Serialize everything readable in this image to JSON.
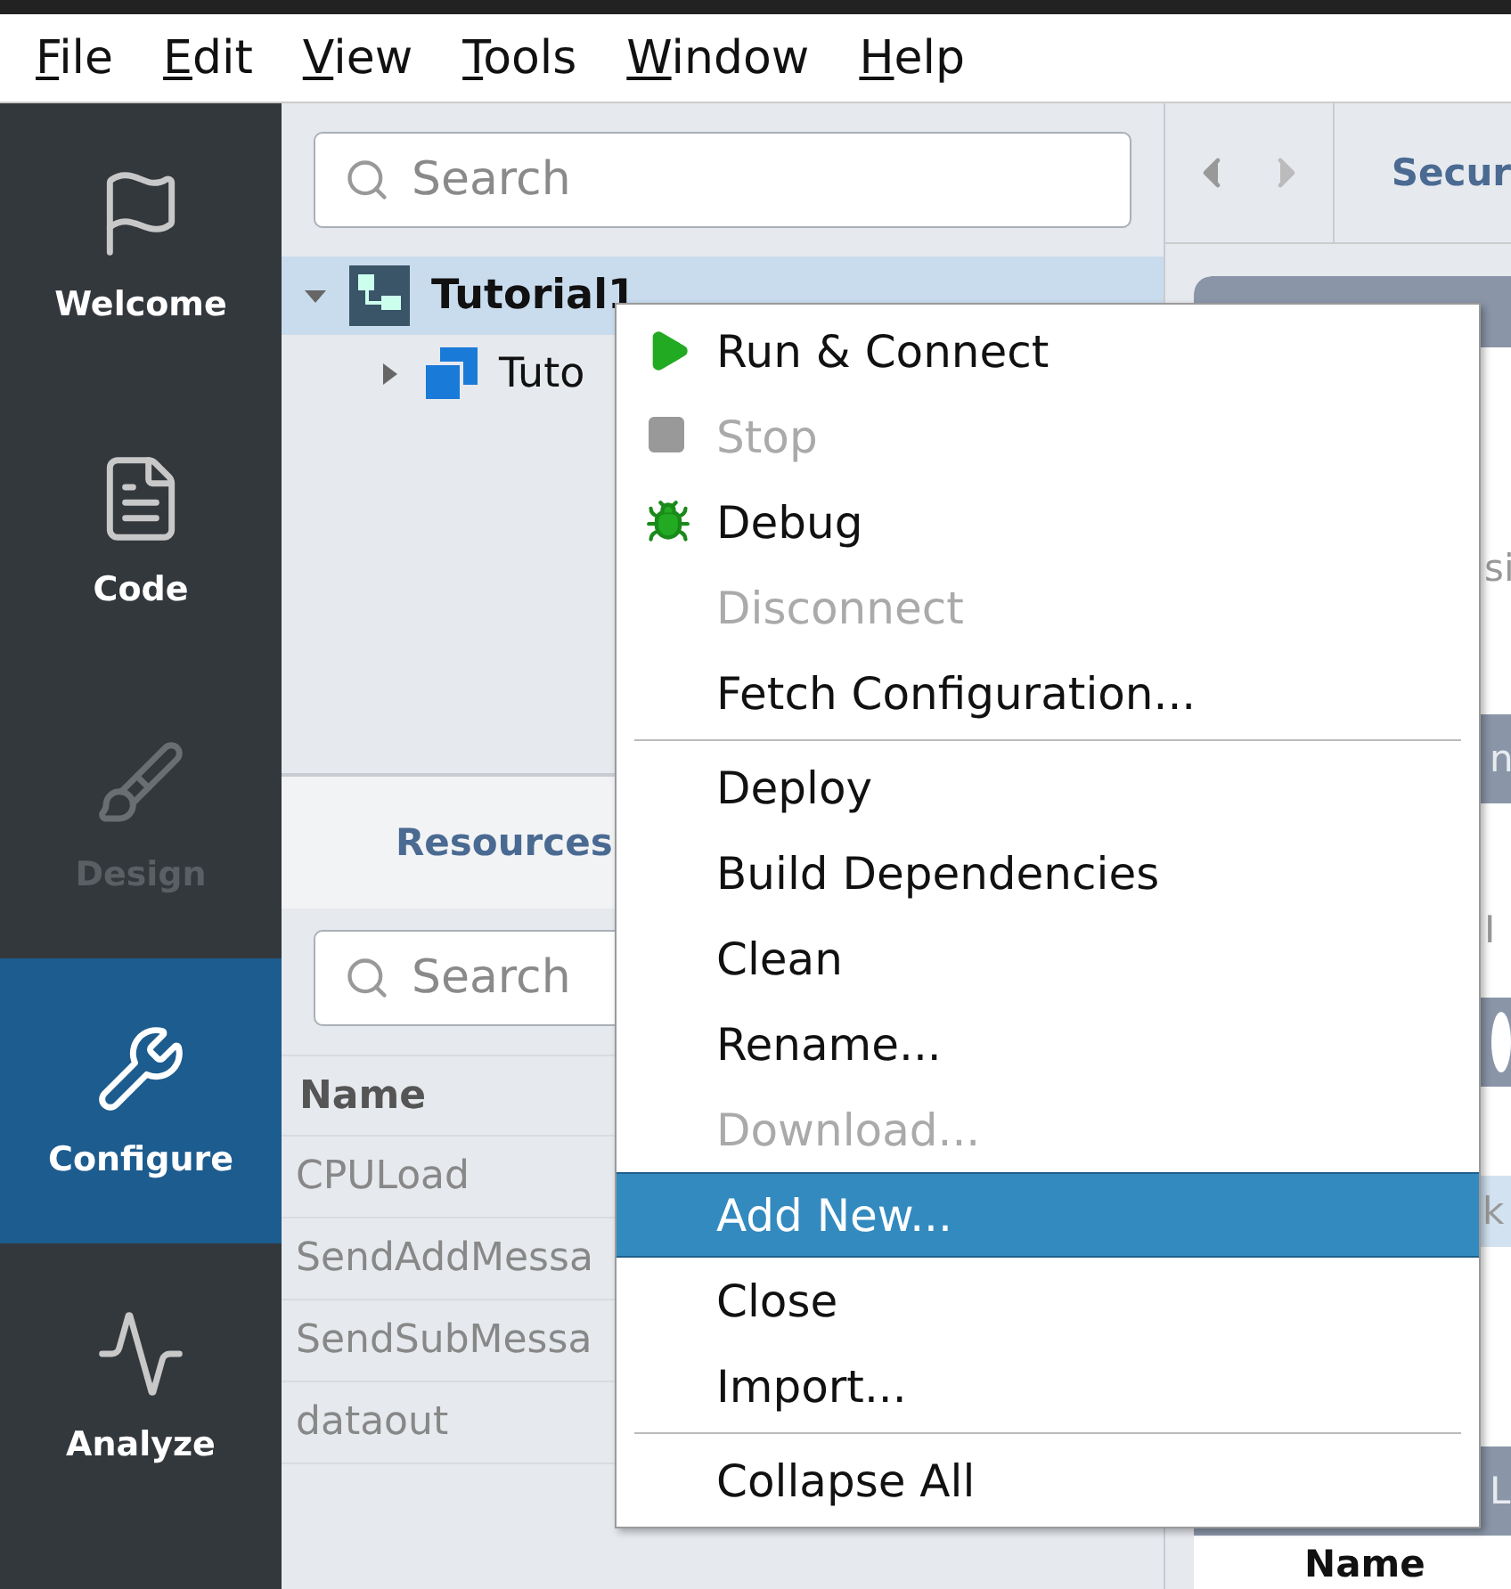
{
  "menu_bar": [
    {
      "label": "File"
    },
    {
      "label": "Edit"
    },
    {
      "label": "View"
    },
    {
      "label": "Tools"
    },
    {
      "label": "Window"
    },
    {
      "label": "Help"
    }
  ],
  "sidebar": {
    "items": [
      {
        "kind": "welcome",
        "label": "Welcome",
        "selected": false,
        "disabled": false
      },
      {
        "kind": "code",
        "label": "Code",
        "selected": false,
        "disabled": false
      },
      {
        "kind": "design",
        "label": "Design",
        "selected": false,
        "disabled": true
      },
      {
        "kind": "configure",
        "label": "Configure",
        "selected": true,
        "disabled": false
      },
      {
        "kind": "analyze",
        "label": "Analyze",
        "selected": false,
        "disabled": false
      }
    ]
  },
  "project_tree": {
    "search": {
      "placeholder": "Search"
    },
    "items": [
      {
        "kind": "project",
        "label": "Tutorial1",
        "selected": true,
        "expanded": true,
        "children": [
          {
            "kind": "module",
            "label": "Tuto",
            "selected": false,
            "expanded": false
          }
        ]
      }
    ]
  },
  "resources": {
    "tab": "Resources",
    "search": {
      "placeholder": "Search"
    },
    "columns": [
      "Name"
    ],
    "rows": [
      "CPULoad",
      "SendAddMessa",
      "SendSubMessa",
      "dataout"
    ]
  },
  "right_panel": {
    "tab": "Secur",
    "fragments": [
      {
        "kind": "text",
        "label": "si"
      },
      {
        "kind": "bar",
        "label": "n"
      },
      {
        "kind": "text",
        "label": "I"
      },
      {
        "kind": "bar"
      },
      {
        "kind": "row",
        "label": "k"
      },
      {
        "kind": "bar",
        "label": "L"
      },
      {
        "kind": "heading",
        "label": "Name"
      }
    ]
  },
  "context_menu": {
    "groups": [
      [
        {
          "kind": "run",
          "label": "Run & Connect",
          "disabled": false,
          "selected": false
        },
        {
          "kind": "stop",
          "label": "Stop",
          "disabled": true,
          "selected": false
        },
        {
          "kind": "debug",
          "label": "Debug",
          "disabled": false,
          "selected": false
        },
        {
          "kind": "plain",
          "label": "Disconnect",
          "disabled": true,
          "selected": false
        },
        {
          "kind": "plain",
          "label": "Fetch Configuration...",
          "disabled": false,
          "selected": false
        }
      ],
      [
        {
          "kind": "plain",
          "label": "Deploy",
          "disabled": false,
          "selected": false
        },
        {
          "kind": "plain",
          "label": "Build Dependencies",
          "disabled": false,
          "selected": false
        },
        {
          "kind": "plain",
          "label": "Clean",
          "disabled": false,
          "selected": false
        },
        {
          "kind": "plain",
          "label": "Rename...",
          "disabled": false,
          "selected": false
        },
        {
          "kind": "plain",
          "label": "Download...",
          "disabled": true,
          "selected": false
        },
        {
          "kind": "plain",
          "label": "Add New...",
          "disabled": false,
          "selected": true
        },
        {
          "kind": "plain",
          "label": "Close",
          "disabled": false,
          "selected": false
        },
        {
          "kind": "plain",
          "label": "Import...",
          "disabled": false,
          "selected": false
        }
      ],
      [
        {
          "kind": "plain",
          "label": "Collapse All",
          "disabled": false,
          "selected": false
        }
      ]
    ]
  }
}
